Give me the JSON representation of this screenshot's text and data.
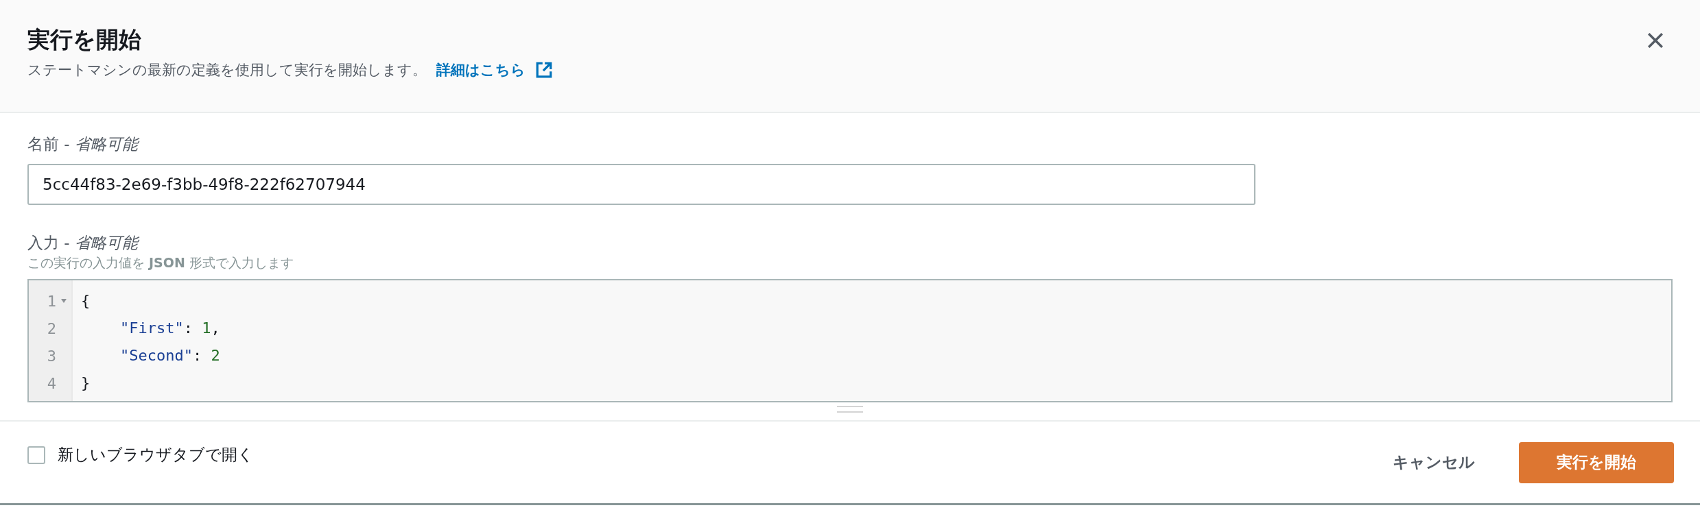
{
  "header": {
    "title": "実行を開始",
    "description": "ステートマシンの最新の定義を使用して実行を開始します。",
    "link": "詳細はこちら"
  },
  "name_field": {
    "label": "名前 - *省略可能*",
    "value": "5cc44f83-2e69-f3bb-49f8-222f62707944"
  },
  "input_field": {
    "label": "入力 - *省略可能*",
    "hint": "この実行の入力値を **JSON** 形式で入力します",
    "lines": [
      {
        "number": "1",
        "foldable": true,
        "indented": false,
        "tokens": [
          {
            "kind": "punct",
            "text": "{"
          }
        ]
      },
      {
        "number": "2",
        "foldable": false,
        "indented": true,
        "tokens": [
          {
            "kind": "key",
            "text": "\"First\""
          },
          {
            "kind": "punct",
            "text": ": "
          },
          {
            "kind": "number",
            "text": "1"
          },
          {
            "kind": "punct",
            "text": ","
          }
        ]
      },
      {
        "number": "3",
        "foldable": false,
        "indented": true,
        "tokens": [
          {
            "kind": "key",
            "text": "\"Second\""
          },
          {
            "kind": "punct",
            "text": ": "
          },
          {
            "kind": "number",
            "text": "2"
          }
        ]
      },
      {
        "number": "4",
        "foldable": false,
        "indented": false,
        "tokens": [
          {
            "kind": "punct",
            "text": "}"
          }
        ]
      }
    ]
  },
  "footer": {
    "new_tab": {
      "label": "新しいブラウザタブで開く",
      "checked": false
    },
    "cancel": "キャンセル",
    "submit": "実行を開始"
  }
}
